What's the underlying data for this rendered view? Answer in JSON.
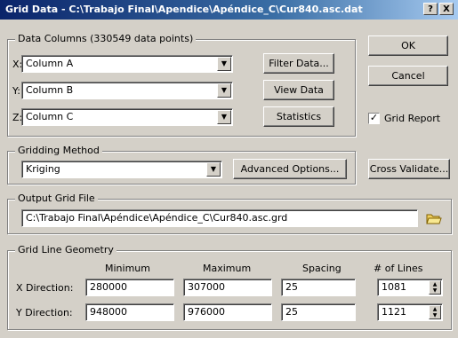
{
  "window": {
    "title": "Grid Data - C:\\Trabajo Final\\Apendice\\Apéndice_C\\Cur840.asc.dat",
    "help_label": "?",
    "close_label": "X"
  },
  "data_columns": {
    "legend": "Data Columns   (330549 data points)",
    "x_label": "X:",
    "x_value": "Column A",
    "y_label": "Y:",
    "y_value": "Column B",
    "z_label": "Z:",
    "z_value": "Column C",
    "filter_label": "Filter Data...",
    "view_label": "View Data",
    "stats_label": "Statistics"
  },
  "buttons": {
    "ok_label": "OK",
    "cancel_label": "Cancel"
  },
  "grid_report": {
    "label": "Grid Report",
    "checked": true
  },
  "gridding": {
    "legend": "Gridding Method",
    "method": "Kriging",
    "advanced_label": "Advanced Options...",
    "cross_label": "Cross Validate..."
  },
  "output": {
    "legend": "Output Grid File",
    "path": "C:\\Trabajo Final\\Apéndice\\Apéndice_C\\Cur840.asc.grd"
  },
  "geometry": {
    "legend": "Grid Line Geometry",
    "col_min": "Minimum",
    "col_max": "Maximum",
    "col_spacing": "Spacing",
    "col_lines": "# of Lines",
    "x_label": "X Direction:",
    "x_min": "280000",
    "x_max": "307000",
    "x_spacing": "25",
    "x_lines": "1081",
    "y_label": "Y Direction:",
    "y_min": "948000",
    "y_max": "976000",
    "y_spacing": "25",
    "y_lines": "1121"
  }
}
